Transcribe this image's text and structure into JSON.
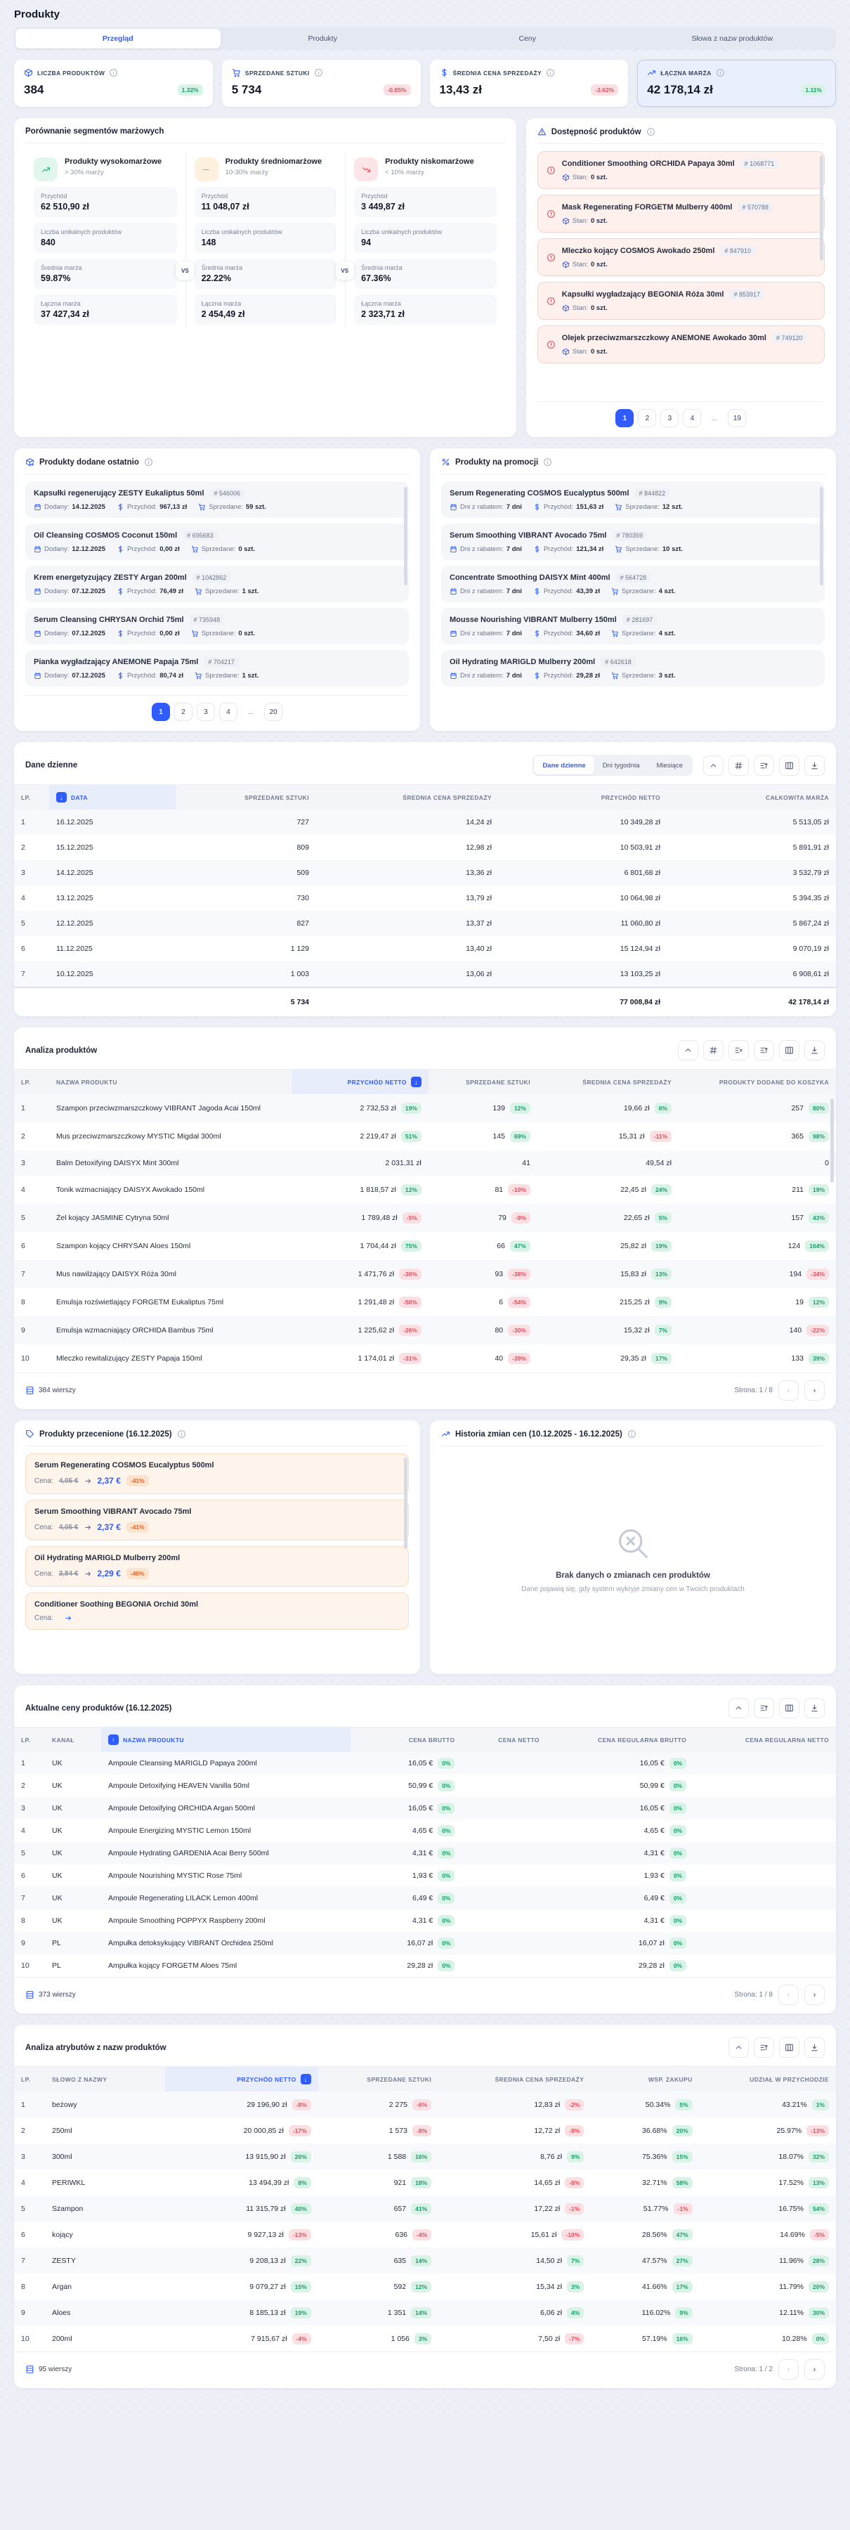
{
  "page": {
    "title": "Produkty"
  },
  "tabs": [
    {
      "label": "Przegląd",
      "active": true
    },
    {
      "label": "Produkty"
    },
    {
      "label": "Ceny"
    },
    {
      "label": "Słowa z nazw produktów"
    }
  ],
  "kpis": [
    {
      "icon": "package",
      "label": "LICZBA PRODUKTÓW",
      "value": "384",
      "delta": "1.32%"
    },
    {
      "icon": "cart",
      "label": "SPRZEDANE SZTUKI",
      "value": "5 734",
      "delta": "-0.85%"
    },
    {
      "icon": "dollar",
      "label": "ŚREDNIA CENA SPRZEDAŻY",
      "value": "13,43 zł",
      "delta": "-3.62%"
    },
    {
      "icon": "trendup",
      "label": "ŁĄCZNA MARŻA",
      "value": "42 178,14 zł",
      "delta": "1.11%",
      "active": true
    }
  ],
  "segments": {
    "title": "Porównanie segmentów marżowych",
    "vs_label": "VS",
    "labels": {
      "przychod": "Przychód",
      "liczba": "Liczba unikalnych produktów",
      "srednia": "Średnia marża",
      "laczna": "Łączna marża"
    },
    "items": [
      {
        "tone": "green",
        "icon": "trendup",
        "name": "Produkty wysokomarżowe",
        "sub": "> 30% marży",
        "przychod": "62 510,90 zł",
        "liczba": "840",
        "srednia": "59.87%",
        "laczna": "37 427,34 zł"
      },
      {
        "tone": "orange",
        "icon": "minus",
        "name": "Produkty średniomarżowe",
        "sub": "10-30% marży",
        "przychod": "11 048,07 zł",
        "liczba": "148",
        "srednia": "22.22%",
        "laczna": "2 454,49 zł"
      },
      {
        "tone": "red",
        "icon": "trenddown",
        "name": "Produkty niskomarżowe",
        "sub": "< 10% marży",
        "przychod": "3 449,87 zł",
        "liczba": "94",
        "srednia": "67.36%",
        "laczna": "2 323,71 zł"
      }
    ]
  },
  "availability": {
    "title": "Dostępność produktów",
    "stock_label": "Stan:",
    "items": [
      {
        "name": "Conditioner Smoothing ORCHIDA Papaya 30ml",
        "id": "# 1068771",
        "stock": "0 szt."
      },
      {
        "name": "Mask Regenerating FORGETM Mulberry 400ml",
        "id": "# 570788",
        "stock": "0 szt."
      },
      {
        "name": "Mleczko kojący COSMOS Awokado 250ml",
        "id": "# 847910",
        "stock": "0 szt."
      },
      {
        "name": "Kapsułki wygładzający BEGONIA Róża 30ml",
        "id": "# 853917",
        "stock": "0 szt."
      },
      {
        "name": "Olejek przeciwzmarszczkowy ANEMONE Awokado 30ml",
        "id": "# 749120",
        "stock": "0 szt."
      }
    ],
    "pages": [
      {
        "label": "1",
        "active": true
      },
      {
        "label": "2"
      },
      {
        "label": "3"
      },
      {
        "label": "4"
      },
      {
        "label": "...",
        "dots": true
      },
      {
        "label": "19"
      }
    ],
    "prev": "‹",
    "next": "›"
  },
  "recent": {
    "title": "Produkty dodane ostatnio",
    "labels": {
      "added": "Dodany:",
      "revenue": "Przychód:",
      "sold": "Sprzedane:"
    },
    "items": [
      {
        "name": "Kapsułki regenerujący ZESTY Eukaliptus 50ml",
        "id": "# 546006",
        "date": "14.12.2025",
        "rev": "967,13 zł",
        "sold": "59 szt."
      },
      {
        "name": "Oil Cleansing COSMOS Coconut 150ml",
        "id": "# 695683",
        "date": "12.12.2025",
        "rev": "0,00 zł",
        "sold": "0 szt."
      },
      {
        "name": "Krem energetyzujący ZESTY Argan 200ml",
        "id": "# 1042862",
        "date": "07.12.2025",
        "rev": "76,49 zł",
        "sold": "1 szt."
      },
      {
        "name": "Serum Cleansing CHRYSAN Orchid 75ml",
        "id": "# 735948",
        "date": "07.12.2025",
        "rev": "0,00 zł",
        "sold": "0 szt."
      },
      {
        "name": "Pianka wygładzający ANEMONE Papaja 75ml",
        "id": "# 704217",
        "date": "07.12.2025",
        "rev": "80,74 zł",
        "sold": "1 szt."
      }
    ],
    "pages": [
      {
        "label": "1",
        "active": true
      },
      {
        "label": "2"
      },
      {
        "label": "3"
      },
      {
        "label": "4"
      },
      {
        "label": "...",
        "dots": true
      },
      {
        "label": "20"
      }
    ],
    "prev": "‹",
    "next": "›"
  },
  "promo": {
    "title": "Produkty na promocji",
    "labels": {
      "days": "Dni z rabatem:",
      "revenue": "Przychód:",
      "sold": "Sprzedane:"
    },
    "items": [
      {
        "name": "Serum Regenerating COSMOS Eucalyptus 500ml",
        "id": "# 844822",
        "days": "7 dni",
        "rev": "151,63 zł",
        "sold": "12 szt."
      },
      {
        "name": "Serum Smoothing VIBRANT Avocado 75ml",
        "id": "# 780359",
        "days": "7 dni",
        "rev": "121,34 zł",
        "sold": "10 szt."
      },
      {
        "name": "Concentrate Smoothing DAISYX Mint 400ml",
        "id": "# 564728",
        "days": "7 dni",
        "rev": "43,39 zł",
        "sold": "4 szt."
      },
      {
        "name": "Mousse Nourishing VIBRANT Mulberry 150ml",
        "id": "# 281697",
        "days": "7 dni",
        "rev": "34,60 zł",
        "sold": "4 szt."
      },
      {
        "name": "Oil Hydrating MARIGLD Mulberry 200ml",
        "id": "# 642618",
        "days": "7 dni",
        "rev": "29,28 zł",
        "sold": "3 szt."
      }
    ]
  },
  "daily": {
    "title": "Dane dzienne",
    "minitabs": [
      {
        "label": "Dane dzienne",
        "active": true
      },
      {
        "label": "Dni tygodnia"
      },
      {
        "label": "Miesiące"
      }
    ],
    "toolbar": [
      {
        "icon": "chevUp"
      },
      {
        "icon": "hash"
      },
      {
        "icon": "filter"
      },
      {
        "icon": "columns"
      },
      {
        "icon": "download"
      }
    ],
    "sort_arrow": "↓",
    "columns": [
      "LP.",
      "DATA",
      "SPRZEDANE SZTUKI",
      "ŚREDNIA CENA SPRZEDAŻY",
      "PRZYCHÓD NETTO",
      "CAŁKOWITA MARŻA"
    ],
    "rows": [
      {
        "lp": "1",
        "date": "16.12.2025",
        "qty": "727",
        "avg": "14,24 zł",
        "rev": "10 349,28 zł",
        "margin": "5 513,05 zł"
      },
      {
        "lp": "2",
        "date": "15.12.2025",
        "qty": "809",
        "avg": "12,98 zł",
        "rev": "10 503,91 zł",
        "margin": "5 891,91 zł"
      },
      {
        "lp": "3",
        "date": "14.12.2025",
        "qty": "509",
        "avg": "13,36 zł",
        "rev": "6 801,68 zł",
        "margin": "3 532,79 zł"
      },
      {
        "lp": "4",
        "date": "13.12.2025",
        "qty": "730",
        "avg": "13,79 zł",
        "rev": "10 064,98 zł",
        "margin": "5 394,35 zł"
      },
      {
        "lp": "5",
        "date": "12.12.2025",
        "qty": "827",
        "avg": "13,37 zł",
        "rev": "11 060,80 zł",
        "margin": "5 867,24 zł"
      },
      {
        "lp": "6",
        "date": "11.12.2025",
        "qty": "1 129",
        "avg": "13,40 zł",
        "rev": "15 124,94 zł",
        "margin": "9 070,19 zł"
      },
      {
        "lp": "7",
        "date": "10.12.2025",
        "qty": "1 003",
        "avg": "13,06 zł",
        "rev": "13 103,25 zł",
        "margin": "6 908,61 zł"
      }
    ],
    "totals": {
      "qty": "5 734",
      "rev": "77 008,84 zł",
      "margin": "42 178,14 zł"
    }
  },
  "products": {
    "title": "Analiza produktów",
    "toolbar": [
      {
        "icon": "chevUp"
      },
      {
        "icon": "hash"
      },
      {
        "icon": "sortx"
      },
      {
        "icon": "filter"
      },
      {
        "icon": "columns"
      },
      {
        "icon": "download"
      }
    ],
    "sort_arrow": "↓",
    "columns": [
      "LP.",
      "NAZWA PRODUKTU",
      "PRZYCHÓD NETTO",
      "SPRZEDANE SZTUKI",
      "ŚREDNIA CENA SPRZEDAŻY",
      "PRODUKTY DODANE DO KOSZYKA"
    ],
    "rows": [
      {
        "lp": "1",
        "name": "Szampon przeciwzmarszczkowy VIBRANT Jagoda Acai 150ml",
        "rev": "2 732,53 zł",
        "revd": "19%",
        "qty": "139",
        "qtyd": "12%",
        "avg": "19,66 zł",
        "avgd": "6%",
        "cart": "257",
        "cartd": "80%"
      },
      {
        "lp": "2",
        "name": "Mus przeciwzmarszczkowy MYSTIC Migdał 300ml",
        "rev": "2 219,47 zł",
        "revd": "51%",
        "qty": "145",
        "qtyd": "69%",
        "avg": "15,31 zł",
        "avgd": "-11%",
        "cart": "365",
        "cartd": "98%"
      },
      {
        "lp": "3",
        "name": "Balm Detoxifying DAISYX Mint 300ml",
        "rev": "2 031,31 zł",
        "revd": "",
        "qty": "41",
        "qtyd": "",
        "avg": "49,54 zł",
        "avgd": "",
        "cart": "0",
        "cartd": ""
      },
      {
        "lp": "4",
        "name": "Tonik wzmacniający DAISYX Awokado 150ml",
        "rev": "1 818,57 zł",
        "revd": "12%",
        "qty": "81",
        "qtyd": "-10%",
        "avg": "22,45 zł",
        "avgd": "24%",
        "cart": "211",
        "cartd": "19%"
      },
      {
        "lp": "5",
        "name": "Żel kojący JASMINE Cytryna 50ml",
        "rev": "1 789,48 zł",
        "revd": "-5%",
        "qty": "79",
        "qtyd": "-9%",
        "avg": "22,65 zł",
        "avgd": "5%",
        "cart": "157",
        "cartd": "43%"
      },
      {
        "lp": "6",
        "name": "Szampon kojący CHRYSAN Aloes 150ml",
        "rev": "1 704,44 zł",
        "revd": "75%",
        "qty": "66",
        "qtyd": "47%",
        "avg": "25,82 zł",
        "avgd": "19%",
        "cart": "124",
        "cartd": "164%"
      },
      {
        "lp": "7",
        "name": "Mus nawilżający DAISYX Róża 30ml",
        "rev": "1 471,76 zł",
        "revd": "-30%",
        "qty": "93",
        "qtyd": "-38%",
        "avg": "15,83 zł",
        "avgd": "13%",
        "cart": "194",
        "cartd": "-34%"
      },
      {
        "lp": "8",
        "name": "Emulsja rozświetlający FORGETM Eukaliptus 75ml",
        "rev": "1 291,48 zł",
        "revd": "-50%",
        "qty": "6",
        "qtyd": "-54%",
        "avg": "215,25 zł",
        "avgd": "9%",
        "cart": "19",
        "cartd": "12%"
      },
      {
        "lp": "9",
        "name": "Emulsja wzmacniający ORCHIDA Bambus 75ml",
        "rev": "1 225,62 zł",
        "revd": "-26%",
        "qty": "80",
        "qtyd": "-30%",
        "avg": "15,32 zł",
        "avgd": "7%",
        "cart": "140",
        "cartd": "-22%"
      },
      {
        "lp": "10",
        "name": "Mleczko rewitalizujący ZESTY Papaja 150ml",
        "rev": "1 174,01 zł",
        "revd": "-31%",
        "qty": "40",
        "qtyd": "-39%",
        "avg": "29,35 zł",
        "avgd": "17%",
        "cart": "133",
        "cartd": "39%"
      }
    ],
    "footer": {
      "rows": "384 wierszy",
      "page": "Strona: 1 / 8",
      "prev": "‹",
      "next": "›"
    }
  },
  "discounted": {
    "title": "Produkty przecenione (16.12.2025)",
    "price_label": "Cena:",
    "items": [
      {
        "name": "Serum Regenerating COSMOS Eucalyptus 500ml",
        "old": "4,05 €",
        "new": "2,37 €",
        "pct": "-41%"
      },
      {
        "name": "Serum Smoothing VIBRANT Avocado 75ml",
        "old": "4,05 €",
        "new": "2,37 €",
        "pct": "-41%"
      },
      {
        "name": "Oil Hydrating MARIGLD Mulberry 200ml",
        "old": "3,84 €",
        "new": "2,29 €",
        "pct": "-40%"
      },
      {
        "name": "Conditioner Soothing BEGONIA Orchid 30ml",
        "old": "",
        "new": "",
        "pct": ""
      }
    ]
  },
  "history": {
    "title": "Historia zmian cen (10.12.2025 - 16.12.2025)",
    "empty_title": "Brak danych o zmianach cen produktów",
    "empty_sub": "Dane pojawią się, gdy system wykryje zmiany cen w Twoich produktach"
  },
  "prices": {
    "title": "Aktualne ceny produktów (16.12.2025)",
    "toolbar": [
      {
        "icon": "chevUp"
      },
      {
        "icon": "filter"
      },
      {
        "icon": "columns"
      },
      {
        "icon": "download"
      }
    ],
    "sort_arrow": "↑",
    "columns": [
      "LP.",
      "KANAŁ",
      "NAZWA PRODUKTU",
      "CENA BRUTTO",
      "CENA NETTO",
      "CENA REGULARNA BRUTTO",
      "CENA REGULARNA NETTO"
    ],
    "rows": [
      {
        "lp": "1",
        "channel": "UK",
        "name": "Ampoule Cleansing MARIGLD Papaya 200ml",
        "gross": "16,05 €",
        "grossd": "0%",
        "net": "",
        "reggross": "16,05 €",
        "reggrossd": "0%",
        "regnet": ""
      },
      {
        "lp": "2",
        "channel": "UK",
        "name": "Ampoule Detoxifying HEAVEN Vanilla 50ml",
        "gross": "50,99 €",
        "grossd": "0%",
        "net": "",
        "reggross": "50,99 €",
        "reggrossd": "0%",
        "regnet": ""
      },
      {
        "lp": "3",
        "channel": "UK",
        "name": "Ampoule Detoxifying ORCHIDA Argan 500ml",
        "gross": "16,05 €",
        "grossd": "0%",
        "net": "",
        "reggross": "16,05 €",
        "reggrossd": "0%",
        "regnet": ""
      },
      {
        "lp": "4",
        "channel": "UK",
        "name": "Ampoule Energizing MYSTIC Lemon 150ml",
        "gross": "4,65 €",
        "grossd": "0%",
        "net": "",
        "reggross": "4,65 €",
        "reggrossd": "0%",
        "regnet": ""
      },
      {
        "lp": "5",
        "channel": "UK",
        "name": "Ampoule Hydrating GARDENIA Acai Berry 500ml",
        "gross": "4,31 €",
        "grossd": "0%",
        "net": "",
        "reggross": "4,31 €",
        "reggrossd": "0%",
        "regnet": ""
      },
      {
        "lp": "6",
        "channel": "UK",
        "name": "Ampoule Nourishing MYSTIC Rose 75ml",
        "gross": "1,93 €",
        "grossd": "0%",
        "net": "",
        "reggross": "1,93 €",
        "reggrossd": "0%",
        "regnet": ""
      },
      {
        "lp": "7",
        "channel": "UK",
        "name": "Ampoule Regenerating LILACK Lemon 400ml",
        "gross": "6,49 €",
        "grossd": "0%",
        "net": "",
        "reggross": "6,49 €",
        "reggrossd": "0%",
        "regnet": ""
      },
      {
        "lp": "8",
        "channel": "UK",
        "name": "Ampoule Smoothing POPPYX Raspberry 200ml",
        "gross": "4,31 €",
        "grossd": "0%",
        "net": "",
        "reggross": "4,31 €",
        "reggrossd": "0%",
        "regnet": ""
      },
      {
        "lp": "9",
        "channel": "PL",
        "name": "Ampułka detoksykujący VIBRANT Orchidea 250ml",
        "gross": "16,07 zł",
        "grossd": "0%",
        "net": "",
        "reggross": "16,07 zł",
        "reggrossd": "0%",
        "regnet": ""
      },
      {
        "lp": "10",
        "channel": "PL",
        "name": "Ampułka kojący FORGETM Aloes 75ml",
        "gross": "29,28 zł",
        "grossd": "0%",
        "net": "",
        "reggross": "29,28 zł",
        "reggrossd": "0%",
        "regnet": ""
      }
    ],
    "footer": {
      "rows": "373 wierszy",
      "page": "Strona: 1 / 8",
      "prev": "‹",
      "next": "›"
    }
  },
  "attrs": {
    "title": "Analiza atrybutów z nazw produktów",
    "toolbar": [
      {
        "icon": "chevUp"
      },
      {
        "icon": "filter"
      },
      {
        "icon": "columns"
      },
      {
        "icon": "download"
      }
    ],
    "sort_arrow": "↓",
    "columns": [
      "LP.",
      "SŁOWO Z NAZWY",
      "PRZYCHÓD NETTO",
      "SPRZEDANE SZTUKI",
      "ŚREDNIA CENA SPRZEDAŻY",
      "WSP. ZAKUPU",
      "UDZIAŁ W PRZYCHODZIE"
    ],
    "rows": [
      {
        "lp": "1",
        "word": "beżowy",
        "rev": "29 196,90 zł",
        "revd": "-8%",
        "qty": "2 275",
        "qtyd": "-6%",
        "avg": "12,83 zł",
        "avgd": "-2%",
        "rate": "50.34%",
        "rated": "5%",
        "share": "43.21%",
        "shared": "1%"
      },
      {
        "lp": "2",
        "word": "250ml",
        "rev": "20 000,85 zł",
        "revd": "-17%",
        "qty": "1 573",
        "qtyd": "-8%",
        "avg": "12,72 zł",
        "avgd": "-9%",
        "rate": "36.68%",
        "rated": "20%",
        "share": "25.97%",
        "shared": "-13%"
      },
      {
        "lp": "3",
        "word": "300ml",
        "rev": "13 915,90 zł",
        "revd": "26%",
        "qty": "1 588",
        "qtyd": "16%",
        "avg": "8,76 zł",
        "avgd": "9%",
        "rate": "75.36%",
        "rated": "15%",
        "share": "18.07%",
        "shared": "32%"
      },
      {
        "lp": "4",
        "word": "PERIWKL",
        "rev": "13 494,39 zł",
        "revd": "8%",
        "qty": "921",
        "qtyd": "18%",
        "avg": "14,65 zł",
        "avgd": "-8%",
        "rate": "32.71%",
        "rated": "58%",
        "share": "17.52%",
        "shared": "13%"
      },
      {
        "lp": "5",
        "word": "Szampon",
        "rev": "11 315,79 zł",
        "revd": "40%",
        "qty": "657",
        "qtyd": "41%",
        "avg": "17,22 zł",
        "avgd": "-1%",
        "rate": "51.77%",
        "rated": "-1%",
        "share": "16.75%",
        "shared": "54%"
      },
      {
        "lp": "6",
        "word": "kojący",
        "rev": "9 927,13 zł",
        "revd": "-13%",
        "qty": "636",
        "qtyd": "-4%",
        "avg": "15,61 zł",
        "avgd": "-10%",
        "rate": "28.56%",
        "rated": "47%",
        "share": "14.69%",
        "shared": "-5%"
      },
      {
        "lp": "7",
        "word": "ZESTY",
        "rev": "9 208,13 zł",
        "revd": "22%",
        "qty": "635",
        "qtyd": "14%",
        "avg": "14,50 zł",
        "avgd": "7%",
        "rate": "47.57%",
        "rated": "27%",
        "share": "11.96%",
        "shared": "28%"
      },
      {
        "lp": "8",
        "word": "Argan",
        "rev": "9 079,27 zł",
        "revd": "15%",
        "qty": "592",
        "qtyd": "12%",
        "avg": "15,34 zł",
        "avgd": "3%",
        "rate": "41.66%",
        "rated": "17%",
        "share": "11.79%",
        "shared": "20%"
      },
      {
        "lp": "9",
        "word": "Aloes",
        "rev": "8 185,13 zł",
        "revd": "19%",
        "qty": "1 351",
        "qtyd": "14%",
        "avg": "6,06 zł",
        "avgd": "4%",
        "rate": "116.02%",
        "rated": "9%",
        "share": "12.11%",
        "shared": "30%"
      },
      {
        "lp": "10",
        "word": "200ml",
        "rev": "7 915,67 zł",
        "revd": "-4%",
        "qty": "1 056",
        "qtyd": "3%",
        "avg": "7,50 zł",
        "avgd": "-7%",
        "rate": "57.19%",
        "rated": "16%",
        "share": "10.28%",
        "shared": "0%"
      }
    ],
    "footer": {
      "rows": "95 wierszy",
      "page": "Strona: 1 / 2",
      "prev": "‹",
      "next": "›"
    }
  }
}
